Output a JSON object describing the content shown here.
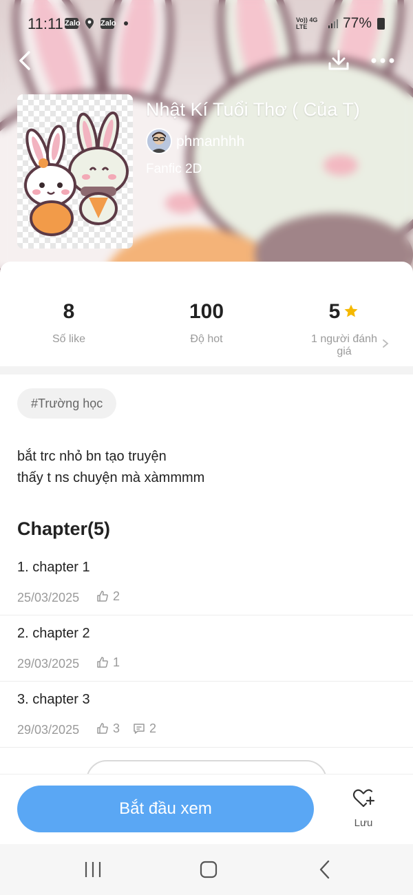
{
  "status_bar": {
    "time": "11:11",
    "app_icons": [
      "Zalo",
      "Zalo"
    ],
    "network_top": "Vo)) 4G",
    "network_bottom": "LTE",
    "battery": "77%"
  },
  "story": {
    "title": "Nhật Kí Tuổi Thơ ( Của T)",
    "author": "phmanhhh",
    "genre": "Fanfic 2D"
  },
  "stats": {
    "likes_value": "8",
    "likes_label": "Số like",
    "hot_value": "100",
    "hot_label": "Độ hot",
    "rating_value": "5",
    "rating_label": "1 người đánh giá"
  },
  "tag": "#Trường học",
  "description": {
    "line1": "bắt trc nhỏ bn tạo truyện",
    "line2": "thấy t ns chuyện mà xàmmmm"
  },
  "chapters_heading": "Chapter(5)",
  "chapters": [
    {
      "title": "1. chapter 1",
      "date": "25/03/2025",
      "likes": "2"
    },
    {
      "title": "2. chapter 2",
      "date": "29/03/2025",
      "likes": "1"
    },
    {
      "title": "3. chapter 3",
      "date": "29/03/2025",
      "likes": "3",
      "comments": "2"
    }
  ],
  "actions": {
    "start_label": "Bắt đầu xem",
    "save_label": "Lưu"
  },
  "colors": {
    "accent_blue": "#5aa7f4",
    "star_yellow": "#f5b800"
  }
}
